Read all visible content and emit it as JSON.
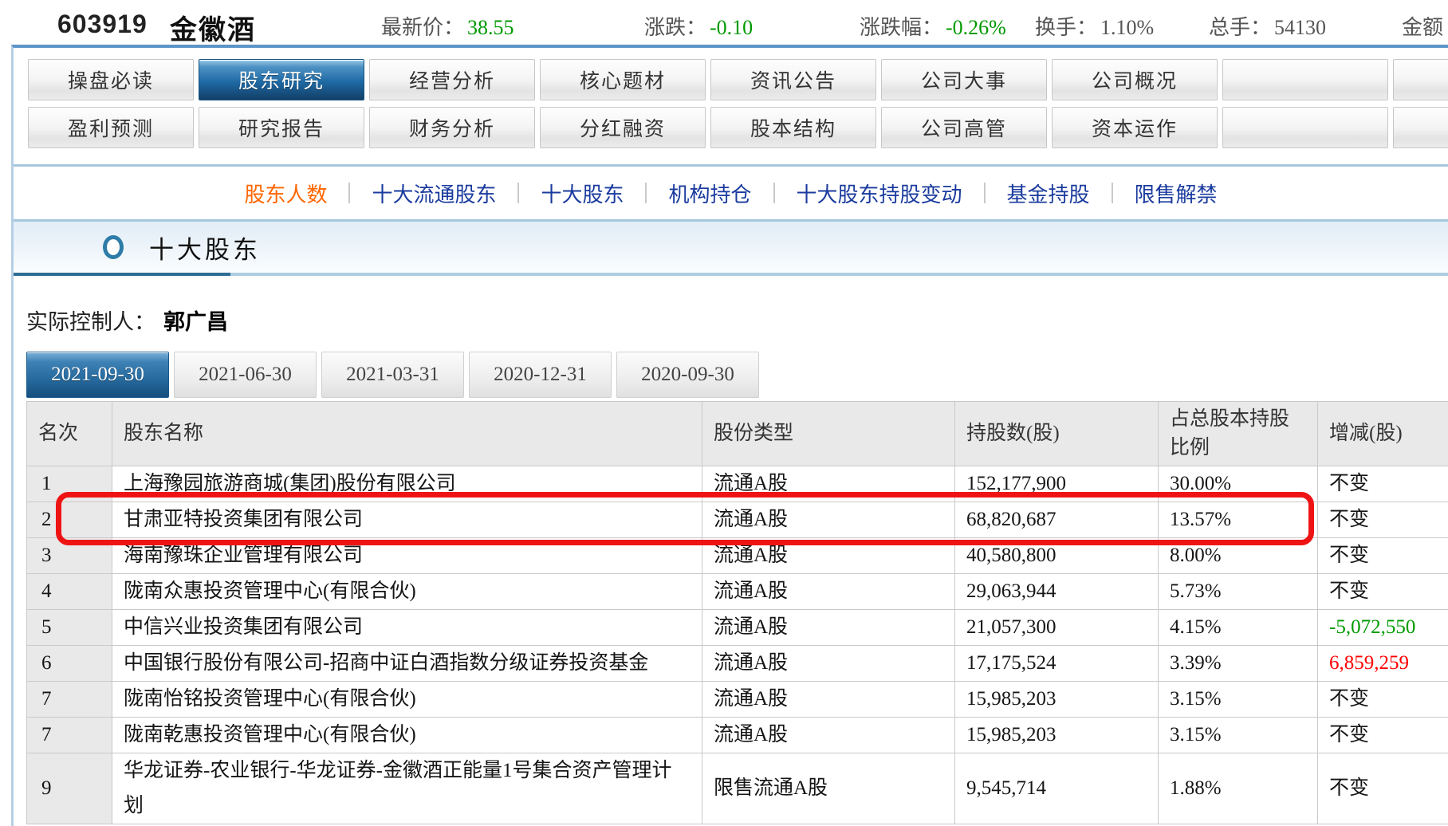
{
  "stock_header": {
    "code": "603919",
    "name": "金徽酒",
    "fields": [
      {
        "label": "最新价：",
        "value": "38.55",
        "color": "green"
      },
      {
        "label": "涨跌：",
        "value": "-0.10",
        "color": "green"
      },
      {
        "label": "涨跌幅：",
        "value": "-0.26%",
        "color": "green"
      },
      {
        "label": "换手：",
        "value": "1.10%",
        "color": "gray"
      },
      {
        "label": "总手：",
        "value": "54130",
        "color": "gray"
      },
      {
        "label": "金额",
        "value": "",
        "color": "gray"
      }
    ]
  },
  "tabs": {
    "active": "股东研究",
    "rows": [
      [
        "操盘必读",
        "股东研究",
        "经营分析",
        "核心题材",
        "资讯公告",
        "公司大事",
        "公司概况",
        "",
        ""
      ],
      [
        "盈利预测",
        "研究报告",
        "财务分析",
        "分红融资",
        "股本结构",
        "公司高管",
        "资本运作",
        "",
        ""
      ]
    ]
  },
  "subnav": {
    "items": [
      {
        "label": "股东人数",
        "active": true
      },
      {
        "label": "十大流通股东",
        "active": false
      },
      {
        "label": "十大股东",
        "active": false
      },
      {
        "label": "机构持仓",
        "active": false
      },
      {
        "label": "十大股东持股变动",
        "active": false
      },
      {
        "label": "基金持股",
        "active": false
      },
      {
        "label": "限售解禁",
        "active": false
      }
    ]
  },
  "section": {
    "title": "十大股东"
  },
  "controller": {
    "label": "实际控制人：",
    "name": "郭广昌"
  },
  "date_tabs": {
    "active": "2021-09-30",
    "items": [
      "2021-09-30",
      "2021-06-30",
      "2021-03-31",
      "2020-12-31",
      "2020-09-30"
    ]
  },
  "table": {
    "columns": [
      "名次",
      "股东名称",
      "股份类型",
      "持股数(股)",
      "占总股本持股比例",
      "增减(股)"
    ],
    "highlight_border_color": "#ef1414",
    "rows": [
      {
        "rank": "1",
        "name": "上海豫园旅游商城(集团)股份有限公司",
        "type": "流通A股",
        "shares": "152,177,900",
        "pct": "30.00%",
        "change": "不变",
        "change_color": "black",
        "highlighted": false
      },
      {
        "rank": "2",
        "name": "甘肃亚特投资集团有限公司",
        "type": "流通A股",
        "shares": "68,820,687",
        "pct": "13.57%",
        "change": "不变",
        "change_color": "black",
        "highlighted": true
      },
      {
        "rank": "3",
        "name": "海南豫珠企业管理有限公司",
        "type": "流通A股",
        "shares": "40,580,800",
        "pct": "8.00%",
        "change": "不变",
        "change_color": "black",
        "highlighted": false
      },
      {
        "rank": "4",
        "name": "陇南众惠投资管理中心(有限合伙)",
        "type": "流通A股",
        "shares": "29,063,944",
        "pct": "5.73%",
        "change": "不变",
        "change_color": "black",
        "highlighted": false
      },
      {
        "rank": "5",
        "name": "中信兴业投资集团有限公司",
        "type": "流通A股",
        "shares": "21,057,300",
        "pct": "4.15%",
        "change": "-5,072,550",
        "change_color": "green",
        "highlighted": false
      },
      {
        "rank": "6",
        "name": "中国银行股份有限公司-招商中证白酒指数分级证券投资基金",
        "type": "流通A股",
        "shares": "17,175,524",
        "pct": "3.39%",
        "change": "6,859,259",
        "change_color": "red",
        "highlighted": false
      },
      {
        "rank": "7",
        "name": "陇南怡铭投资管理中心(有限合伙)",
        "type": "流通A股",
        "shares": "15,985,203",
        "pct": "3.15%",
        "change": "不变",
        "change_color": "black",
        "highlighted": false
      },
      {
        "rank": "7",
        "name": "陇南乾惠投资管理中心(有限合伙)",
        "type": "流通A股",
        "shares": "15,985,203",
        "pct": "3.15%",
        "change": "不变",
        "change_color": "black",
        "highlighted": false
      },
      {
        "rank": "9",
        "name": "华龙证券-农业银行-华龙证券-金徽酒正能量1号集合资产管理计划",
        "type": "限售流通A股",
        "shares": "9,545,714",
        "pct": "1.88%",
        "change": "不变",
        "change_color": "black",
        "highlighted": false
      }
    ]
  },
  "colors": {
    "up_red": "#ff0000",
    "down_green": "#009a00",
    "active_orange": "#ff6600",
    "link_blue": "#1a3b9e",
    "panel_border_blue": "#5c95c7"
  }
}
